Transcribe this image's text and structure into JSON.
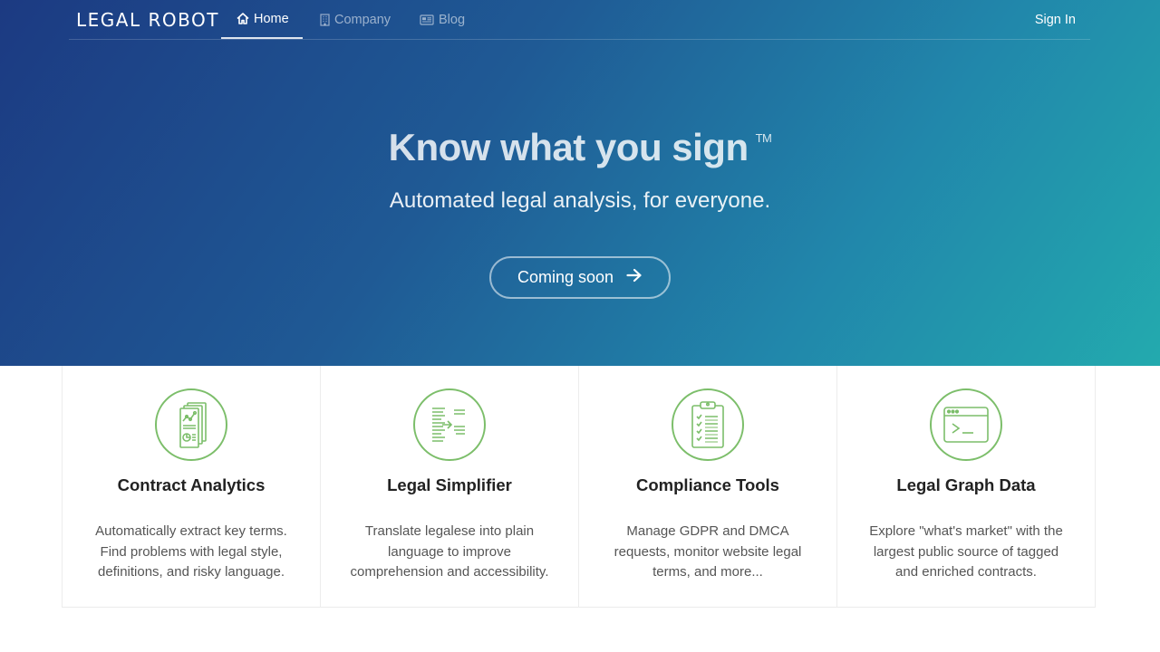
{
  "nav": {
    "logo": "LEGAL ROBOT",
    "items": [
      {
        "label": "Home",
        "icon": "home-icon",
        "active": true
      },
      {
        "label": "Company",
        "icon": "building-icon",
        "active": false
      },
      {
        "label": "Blog",
        "icon": "newspaper-icon",
        "active": false
      }
    ],
    "sign_in": "Sign In"
  },
  "hero": {
    "headline": "Know what you sign",
    "trademark": "TM",
    "subheadline": "Automated legal analysis, for everyone.",
    "cta_label": "Coming soon",
    "cta_icon": "arrow-right-icon"
  },
  "features": [
    {
      "title": "Contract Analytics",
      "icon": "document-analytics-icon",
      "description": "Automatically extract key terms. Find problems with legal style, definitions, and risky language."
    },
    {
      "title": "Legal Simplifier",
      "icon": "text-simplify-icon",
      "description": "Translate legalese into plain language to improve comprehension and accessibility."
    },
    {
      "title": "Compliance Tools",
      "icon": "checklist-clipboard-icon",
      "description": "Manage GDPR and DMCA requests, monitor website legal terms, and more..."
    },
    {
      "title": "Legal Graph Data",
      "icon": "terminal-window-icon",
      "description": "Explore \"what's market\" with the largest public source of tagged and enriched contracts."
    }
  ],
  "colors": {
    "hero_gradient_start": "#1c3a82",
    "hero_gradient_end": "#23aaae",
    "icon_accent": "#7cbe6a"
  }
}
